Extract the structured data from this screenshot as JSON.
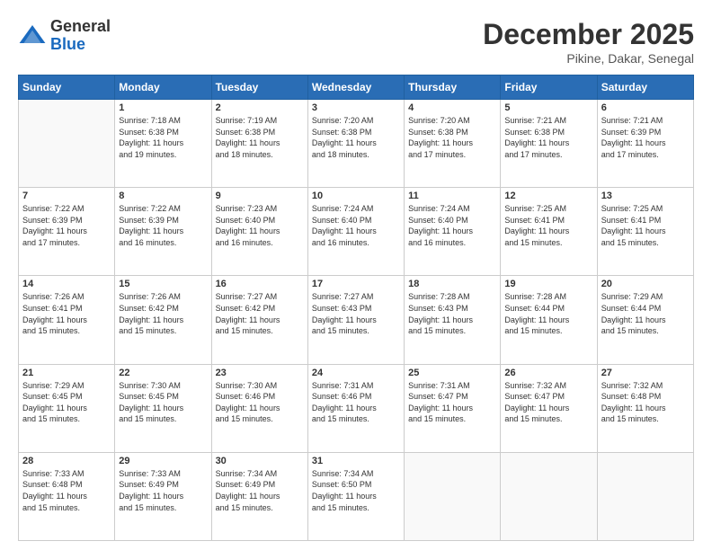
{
  "header": {
    "logo": {
      "line1": "General",
      "line2": "Blue"
    },
    "title": "December 2025",
    "location": "Pikine, Dakar, Senegal"
  },
  "days_of_week": [
    "Sunday",
    "Monday",
    "Tuesday",
    "Wednesday",
    "Thursday",
    "Friday",
    "Saturday"
  ],
  "weeks": [
    [
      {
        "day": "",
        "sunrise": "",
        "sunset": "",
        "daylight": ""
      },
      {
        "day": "1",
        "sunrise": "Sunrise: 7:18 AM",
        "sunset": "Sunset: 6:38 PM",
        "daylight": "Daylight: 11 hours",
        "daylight2": "and 19 minutes."
      },
      {
        "day": "2",
        "sunrise": "Sunrise: 7:19 AM",
        "sunset": "Sunset: 6:38 PM",
        "daylight": "Daylight: 11 hours",
        "daylight2": "and 18 minutes."
      },
      {
        "day": "3",
        "sunrise": "Sunrise: 7:20 AM",
        "sunset": "Sunset: 6:38 PM",
        "daylight": "Daylight: 11 hours",
        "daylight2": "and 18 minutes."
      },
      {
        "day": "4",
        "sunrise": "Sunrise: 7:20 AM",
        "sunset": "Sunset: 6:38 PM",
        "daylight": "Daylight: 11 hours",
        "daylight2": "and 17 minutes."
      },
      {
        "day": "5",
        "sunrise": "Sunrise: 7:21 AM",
        "sunset": "Sunset: 6:38 PM",
        "daylight": "Daylight: 11 hours",
        "daylight2": "and 17 minutes."
      },
      {
        "day": "6",
        "sunrise": "Sunrise: 7:21 AM",
        "sunset": "Sunset: 6:39 PM",
        "daylight": "Daylight: 11 hours",
        "daylight2": "and 17 minutes."
      }
    ],
    [
      {
        "day": "7",
        "sunrise": "Sunrise: 7:22 AM",
        "sunset": "Sunset: 6:39 PM",
        "daylight": "Daylight: 11 hours",
        "daylight2": "and 17 minutes."
      },
      {
        "day": "8",
        "sunrise": "Sunrise: 7:22 AM",
        "sunset": "Sunset: 6:39 PM",
        "daylight": "Daylight: 11 hours",
        "daylight2": "and 16 minutes."
      },
      {
        "day": "9",
        "sunrise": "Sunrise: 7:23 AM",
        "sunset": "Sunset: 6:40 PM",
        "daylight": "Daylight: 11 hours",
        "daylight2": "and 16 minutes."
      },
      {
        "day": "10",
        "sunrise": "Sunrise: 7:24 AM",
        "sunset": "Sunset: 6:40 PM",
        "daylight": "Daylight: 11 hours",
        "daylight2": "and 16 minutes."
      },
      {
        "day": "11",
        "sunrise": "Sunrise: 7:24 AM",
        "sunset": "Sunset: 6:40 PM",
        "daylight": "Daylight: 11 hours",
        "daylight2": "and 16 minutes."
      },
      {
        "day": "12",
        "sunrise": "Sunrise: 7:25 AM",
        "sunset": "Sunset: 6:41 PM",
        "daylight": "Daylight: 11 hours",
        "daylight2": "and 15 minutes."
      },
      {
        "day": "13",
        "sunrise": "Sunrise: 7:25 AM",
        "sunset": "Sunset: 6:41 PM",
        "daylight": "Daylight: 11 hours",
        "daylight2": "and 15 minutes."
      }
    ],
    [
      {
        "day": "14",
        "sunrise": "Sunrise: 7:26 AM",
        "sunset": "Sunset: 6:41 PM",
        "daylight": "Daylight: 11 hours",
        "daylight2": "and 15 minutes."
      },
      {
        "day": "15",
        "sunrise": "Sunrise: 7:26 AM",
        "sunset": "Sunset: 6:42 PM",
        "daylight": "Daylight: 11 hours",
        "daylight2": "and 15 minutes."
      },
      {
        "day": "16",
        "sunrise": "Sunrise: 7:27 AM",
        "sunset": "Sunset: 6:42 PM",
        "daylight": "Daylight: 11 hours",
        "daylight2": "and 15 minutes."
      },
      {
        "day": "17",
        "sunrise": "Sunrise: 7:27 AM",
        "sunset": "Sunset: 6:43 PM",
        "daylight": "Daylight: 11 hours",
        "daylight2": "and 15 minutes."
      },
      {
        "day": "18",
        "sunrise": "Sunrise: 7:28 AM",
        "sunset": "Sunset: 6:43 PM",
        "daylight": "Daylight: 11 hours",
        "daylight2": "and 15 minutes."
      },
      {
        "day": "19",
        "sunrise": "Sunrise: 7:28 AM",
        "sunset": "Sunset: 6:44 PM",
        "daylight": "Daylight: 11 hours",
        "daylight2": "and 15 minutes."
      },
      {
        "day": "20",
        "sunrise": "Sunrise: 7:29 AM",
        "sunset": "Sunset: 6:44 PM",
        "daylight": "Daylight: 11 hours",
        "daylight2": "and 15 minutes."
      }
    ],
    [
      {
        "day": "21",
        "sunrise": "Sunrise: 7:29 AM",
        "sunset": "Sunset: 6:45 PM",
        "daylight": "Daylight: 11 hours",
        "daylight2": "and 15 minutes."
      },
      {
        "day": "22",
        "sunrise": "Sunrise: 7:30 AM",
        "sunset": "Sunset: 6:45 PM",
        "daylight": "Daylight: 11 hours",
        "daylight2": "and 15 minutes."
      },
      {
        "day": "23",
        "sunrise": "Sunrise: 7:30 AM",
        "sunset": "Sunset: 6:46 PM",
        "daylight": "Daylight: 11 hours",
        "daylight2": "and 15 minutes."
      },
      {
        "day": "24",
        "sunrise": "Sunrise: 7:31 AM",
        "sunset": "Sunset: 6:46 PM",
        "daylight": "Daylight: 11 hours",
        "daylight2": "and 15 minutes."
      },
      {
        "day": "25",
        "sunrise": "Sunrise: 7:31 AM",
        "sunset": "Sunset: 6:47 PM",
        "daylight": "Daylight: 11 hours",
        "daylight2": "and 15 minutes."
      },
      {
        "day": "26",
        "sunrise": "Sunrise: 7:32 AM",
        "sunset": "Sunset: 6:47 PM",
        "daylight": "Daylight: 11 hours",
        "daylight2": "and 15 minutes."
      },
      {
        "day": "27",
        "sunrise": "Sunrise: 7:32 AM",
        "sunset": "Sunset: 6:48 PM",
        "daylight": "Daylight: 11 hours",
        "daylight2": "and 15 minutes."
      }
    ],
    [
      {
        "day": "28",
        "sunrise": "Sunrise: 7:33 AM",
        "sunset": "Sunset: 6:48 PM",
        "daylight": "Daylight: 11 hours",
        "daylight2": "and 15 minutes."
      },
      {
        "day": "29",
        "sunrise": "Sunrise: 7:33 AM",
        "sunset": "Sunset: 6:49 PM",
        "daylight": "Daylight: 11 hours",
        "daylight2": "and 15 minutes."
      },
      {
        "day": "30",
        "sunrise": "Sunrise: 7:34 AM",
        "sunset": "Sunset: 6:49 PM",
        "daylight": "Daylight: 11 hours",
        "daylight2": "and 15 minutes."
      },
      {
        "day": "31",
        "sunrise": "Sunrise: 7:34 AM",
        "sunset": "Sunset: 6:50 PM",
        "daylight": "Daylight: 11 hours",
        "daylight2": "and 15 minutes."
      },
      {
        "day": "",
        "sunrise": "",
        "sunset": "",
        "daylight": ""
      },
      {
        "day": "",
        "sunrise": "",
        "sunset": "",
        "daylight": ""
      },
      {
        "day": "",
        "sunrise": "",
        "sunset": "",
        "daylight": ""
      }
    ]
  ]
}
